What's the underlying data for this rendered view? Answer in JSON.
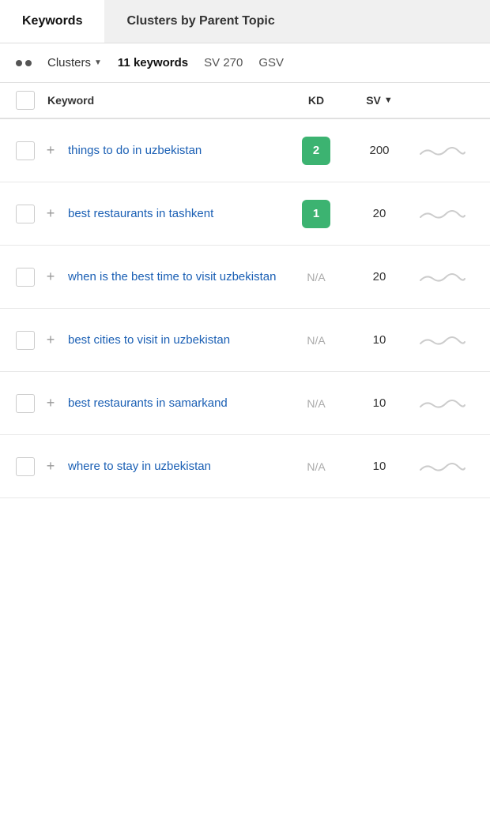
{
  "tabs": [
    {
      "label": "Keywords",
      "active": false
    },
    {
      "label": "Clusters by Parent Topic",
      "active": true
    }
  ],
  "filterBar": {
    "clustersLabel": "Clusters",
    "keywordsCount": "11 keywords",
    "sv": "SV 270",
    "gsv": "GSV"
  },
  "tableHeader": {
    "keywordCol": "Keyword",
    "kdCol": "KD",
    "svCol": "SV"
  },
  "rows": [
    {
      "keyword": "things to do in uzbekistan",
      "kd": "2",
      "kdType": "badge-green",
      "sv": "200",
      "hasTrend": true
    },
    {
      "keyword": "best restaurants in tashkent",
      "kd": "1",
      "kdType": "badge-green",
      "sv": "20",
      "hasTrend": true
    },
    {
      "keyword": "when is the best time to visit uzbekistan",
      "kd": "N/A",
      "kdType": "na",
      "sv": "20",
      "hasTrend": true
    },
    {
      "keyword": "best cities to visit in uzbekistan",
      "kd": "N/A",
      "kdType": "na",
      "sv": "10",
      "hasTrend": true
    },
    {
      "keyword": "best restaurants in samarkand",
      "kd": "N/A",
      "kdType": "na",
      "sv": "10",
      "hasTrend": true
    },
    {
      "keyword": "where to stay in uzbekistan",
      "kd": "N/A",
      "kdType": "na",
      "sv": "10",
      "hasTrend": true
    }
  ]
}
